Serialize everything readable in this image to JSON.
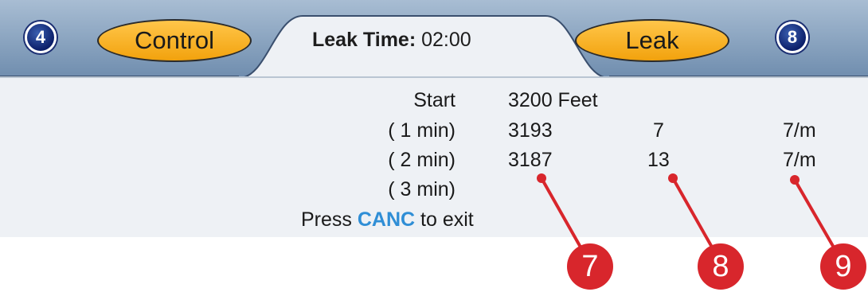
{
  "header": {
    "left_badge": "4",
    "left_button": "Control",
    "title_label": "Leak Time:",
    "title_value": "02:00",
    "right_button": "Leak",
    "right_badge": "8"
  },
  "rows": [
    {
      "label": "Start",
      "value": "3200 Feet",
      "diff": "",
      "rate": ""
    },
    {
      "label": "( 1 min)",
      "value": "3193",
      "diff": "7",
      "rate": "7/m"
    },
    {
      "label": "( 2 min)",
      "value": "3187",
      "diff": "13",
      "rate": "7/m"
    },
    {
      "label": "( 3 min)",
      "value": "",
      "diff": "",
      "rate": ""
    }
  ],
  "footer": {
    "press": "Press",
    "key": "CANC",
    "suffix": "to exit"
  },
  "callouts": [
    "7",
    "8",
    "9"
  ],
  "colors": {
    "accent_button": "#f5ad1f",
    "header_bar": "#7e9ab8",
    "screen_bg": "#eef1f5",
    "key_text": "#2f8ed6",
    "callout": "#d8262c"
  }
}
